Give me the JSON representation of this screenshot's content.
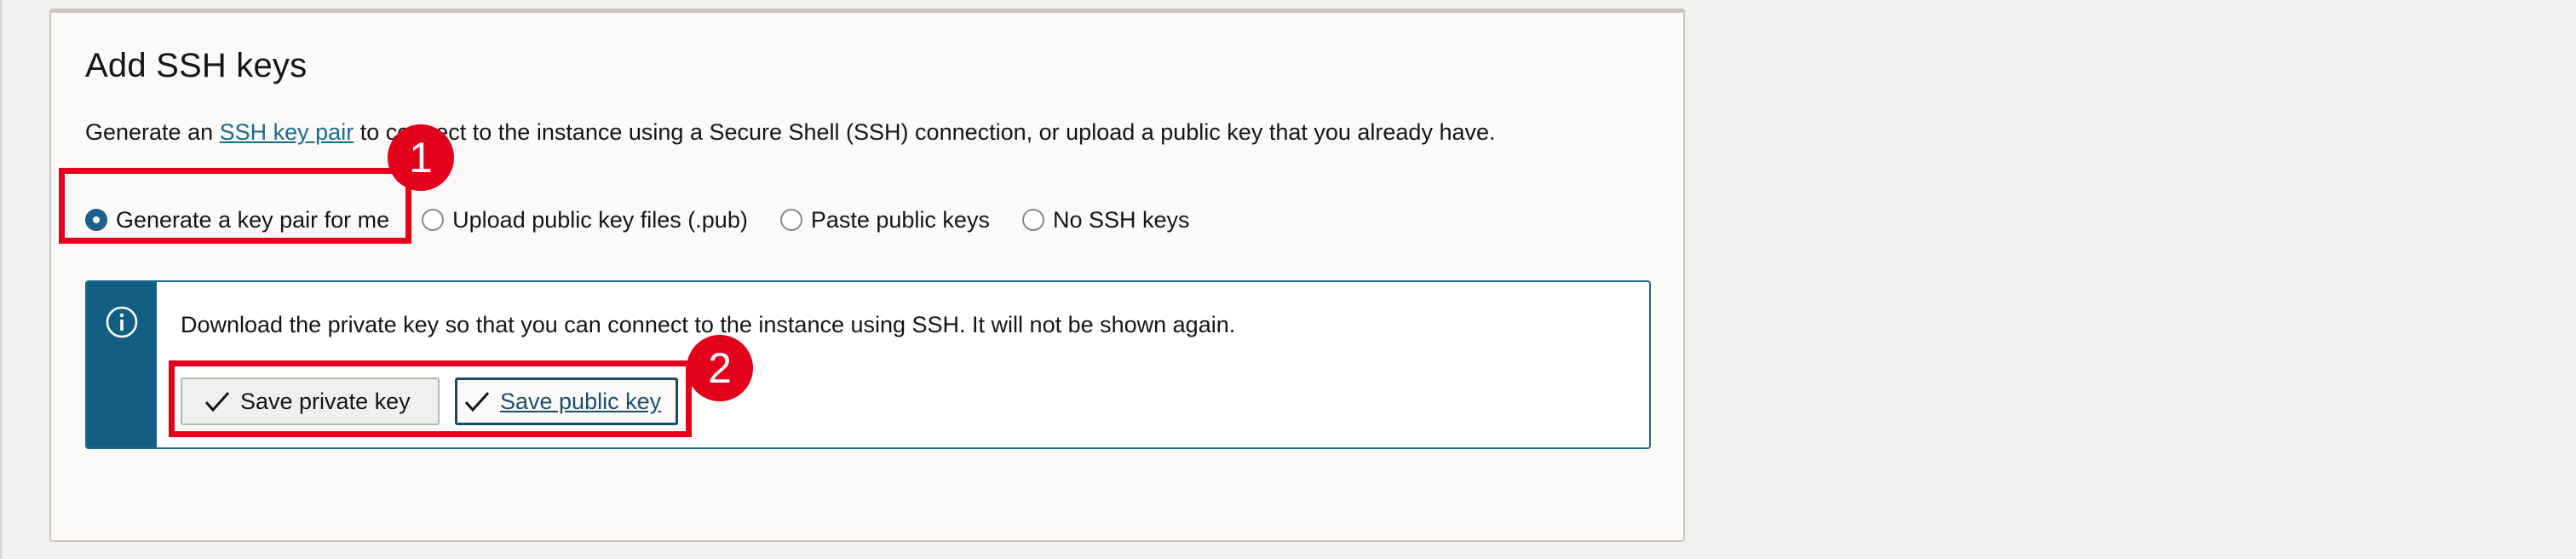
{
  "section": {
    "title": "Add SSH keys",
    "intro_before": "Generate an ",
    "intro_link": "SSH key pair",
    "intro_after": " to connect to the instance using a Secure Shell (SSH) connection, or upload a public key that you already have."
  },
  "ssh_options": [
    {
      "label": "Generate a key pair for me",
      "checked": true
    },
    {
      "label": "Upload public key files (.pub)",
      "checked": false
    },
    {
      "label": "Paste public keys",
      "checked": false
    },
    {
      "label": "No SSH keys",
      "checked": false
    }
  ],
  "info": {
    "icon": "info-icon",
    "message": "Download the private key so that you can connect to the instance using SSH. It will not be shown again."
  },
  "buttons": {
    "save_private": "Save private key",
    "save_public": "Save public key"
  },
  "annotations": {
    "badge_1": "1",
    "badge_2": "2",
    "highlight_color": "#e2001a"
  },
  "colors": {
    "accent": "#125f83",
    "link": "#1b6a8f"
  }
}
